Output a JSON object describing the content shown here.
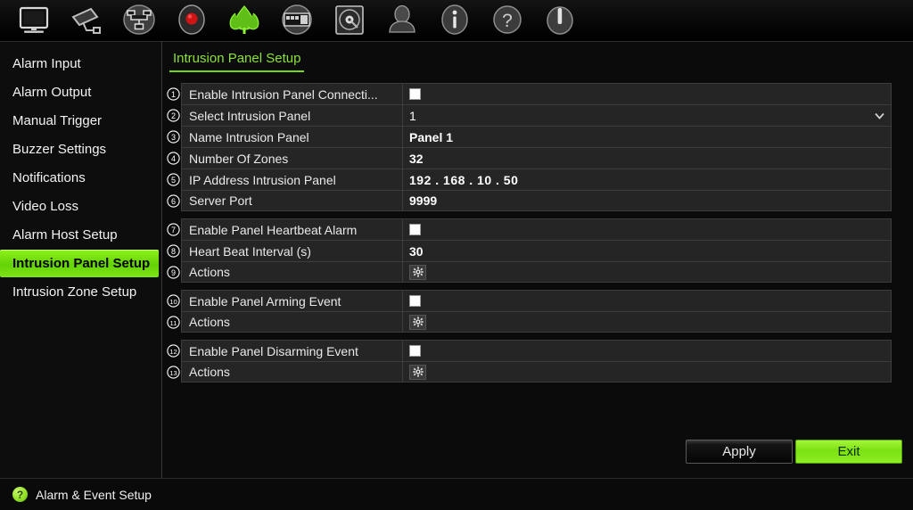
{
  "toolbar": {
    "items": [
      {
        "name": "monitor-icon",
        "label": "Live View"
      },
      {
        "name": "camera-icon",
        "label": "Playback"
      },
      {
        "name": "network-icon",
        "label": "Network"
      },
      {
        "name": "record-icon",
        "label": "Recording"
      },
      {
        "name": "alarm-leaf-icon",
        "label": "Alarm & Event Setup"
      },
      {
        "name": "display-icon",
        "label": "Display"
      },
      {
        "name": "hard-disk-icon",
        "label": "Storage"
      },
      {
        "name": "user-icon",
        "label": "User Management"
      },
      {
        "name": "info-icon",
        "label": "System Information"
      },
      {
        "name": "help-icon",
        "label": "Help"
      },
      {
        "name": "power-icon",
        "label": "Shutdown"
      }
    ]
  },
  "sidebar": {
    "items": [
      {
        "label": "Alarm Input",
        "active": false
      },
      {
        "label": "Alarm Output",
        "active": false
      },
      {
        "label": "Manual Trigger",
        "active": false
      },
      {
        "label": "Buzzer Settings",
        "active": false
      },
      {
        "label": "Notifications",
        "active": false
      },
      {
        "label": "Video Loss",
        "active": false
      },
      {
        "label": "Alarm Host Setup",
        "active": false
      },
      {
        "label": "Intrusion Panel Setup",
        "active": true
      },
      {
        "label": "Intrusion Zone Setup",
        "active": false
      }
    ]
  },
  "main": {
    "tab_label": "Intrusion Panel Setup",
    "groups": [
      {
        "rows": [
          {
            "num": "1",
            "label": "Enable Intrusion Panel Connecti...",
            "type": "checkbox",
            "checked": false
          },
          {
            "num": "2",
            "label": "Select Intrusion Panel",
            "type": "dropdown",
            "value": "1"
          },
          {
            "num": "3",
            "label": "Name Intrusion Panel",
            "type": "text",
            "value": "Panel 1"
          },
          {
            "num": "4",
            "label": "Number Of Zones",
            "type": "text",
            "value": "32"
          },
          {
            "num": "5",
            "label": "IP Address Intrusion Panel",
            "type": "text",
            "value": "192 . 168 . 10   . 50"
          },
          {
            "num": "6",
            "label": "Server Port",
            "type": "text",
            "value": "9999"
          }
        ]
      },
      {
        "rows": [
          {
            "num": "7",
            "label": "Enable Panel Heartbeat Alarm",
            "type": "checkbox",
            "checked": false
          },
          {
            "num": "8",
            "label": "Heart Beat Interval (s)",
            "type": "text",
            "value": "30"
          },
          {
            "num": "9",
            "label": "Actions",
            "type": "gear"
          }
        ]
      },
      {
        "rows": [
          {
            "num": "10",
            "label": "Enable Panel Arming Event",
            "type": "checkbox",
            "checked": false
          },
          {
            "num": "11",
            "label": "Actions",
            "type": "gear"
          }
        ]
      },
      {
        "rows": [
          {
            "num": "12",
            "label": "Enable Panel Disarming Event",
            "type": "checkbox",
            "checked": false
          },
          {
            "num": "13",
            "label": "Actions",
            "type": "gear"
          }
        ]
      }
    ],
    "buttons": {
      "apply_label": "Apply",
      "exit_label": "Exit"
    }
  },
  "statusbar": {
    "icon": "help-circle-icon",
    "icon_glyph": "?",
    "text": "Alarm & Event Setup"
  },
  "colors": {
    "accent_green": "#8ae235",
    "highlight_green": "#76d61c",
    "panel_bg": "#252525",
    "border": "#3d3d3d"
  }
}
